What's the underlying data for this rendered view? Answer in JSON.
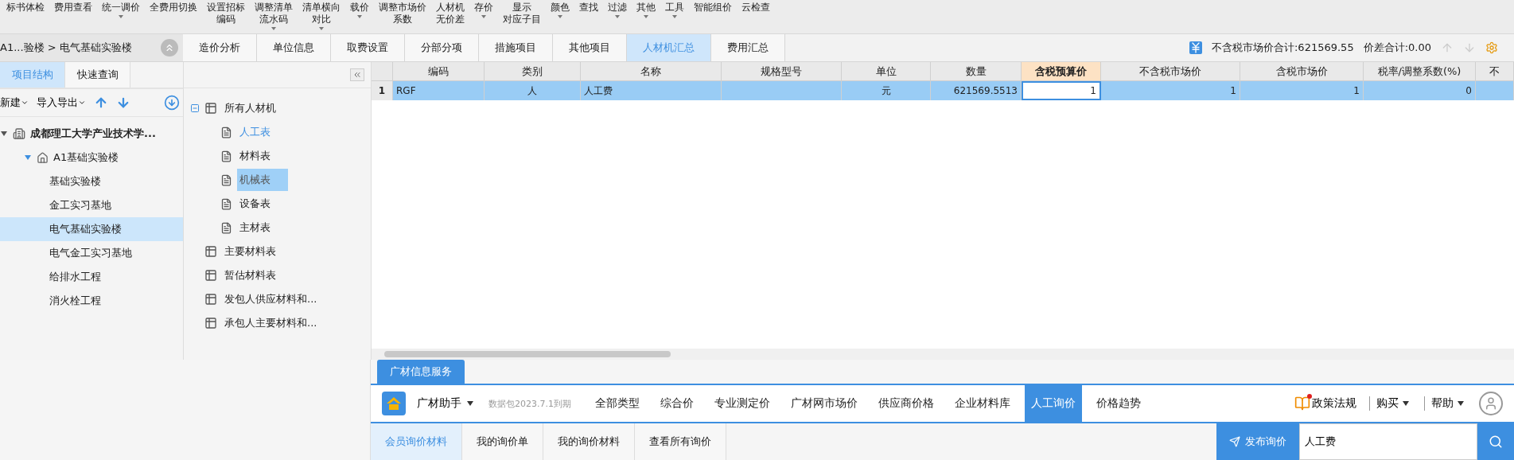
{
  "toolbar": [
    {
      "lines": [
        "标书体检"
      ],
      "dropdown": false
    },
    {
      "lines": [
        "费用查看"
      ],
      "dropdown": false
    },
    {
      "lines": [
        "统一调价"
      ],
      "dropdown": true
    },
    {
      "lines": [
        "全费用切换"
      ],
      "dropdown": false
    },
    {
      "lines": [
        "设置招标",
        "编码"
      ],
      "dropdown": false
    },
    {
      "lines": [
        "调整清单",
        "流水码"
      ],
      "dropdown": true
    },
    {
      "lines": [
        "清单横向",
        "对比"
      ],
      "dropdown": true
    },
    {
      "lines": [
        "载价"
      ],
      "dropdown": true
    },
    {
      "lines": [
        "调整市场价",
        "系数"
      ],
      "dropdown": false
    },
    {
      "lines": [
        "人材机",
        "无价差"
      ],
      "dropdown": false
    },
    {
      "lines": [
        "存价"
      ],
      "dropdown": true
    },
    {
      "lines": [
        "显示",
        "对应子目"
      ],
      "dropdown": false
    },
    {
      "lines": [
        "颜色"
      ],
      "dropdown": true
    },
    {
      "lines": [
        "查找"
      ],
      "dropdown": false
    },
    {
      "lines": [
        "过滤"
      ],
      "dropdown": true
    },
    {
      "lines": [
        "其他"
      ],
      "dropdown": true
    },
    {
      "lines": [
        "工具"
      ],
      "dropdown": true
    },
    {
      "lines": [
        "智能组价"
      ],
      "dropdown": false
    },
    {
      "lines": [
        "云检查"
      ],
      "dropdown": false
    }
  ],
  "breadcrumb": "A1...验楼 > 电气基础实验楼",
  "main_tabs": [
    {
      "label": "造价分析",
      "selected": false
    },
    {
      "label": "单位信息",
      "selected": false
    },
    {
      "label": "取费设置",
      "selected": false
    },
    {
      "label": "分部分项",
      "selected": false
    },
    {
      "label": "措施项目",
      "selected": false
    },
    {
      "label": "其他项目",
      "selected": false
    },
    {
      "label": "人材机汇总",
      "selected": true
    },
    {
      "label": "费用汇总",
      "selected": false
    }
  ],
  "summary": {
    "market_total": "不含税市场价合计:621569.55",
    "diff_total": "价差合计:0.00"
  },
  "left_tabs": [
    {
      "label": "项目结构",
      "selected": true
    },
    {
      "label": "快速查询",
      "selected": false
    }
  ],
  "left_tools": {
    "new": "新建",
    "import_export": "导入导出"
  },
  "project_tree": [
    {
      "label": "成都理工大学产业技术学...",
      "kind": "project",
      "expanded": true,
      "selected": false,
      "children": [
        {
          "label": "A1基础实验楼",
          "kind": "building",
          "expanded": true,
          "selected": false,
          "children": [
            {
              "label": "基础实验楼",
              "selected": false
            },
            {
              "label": "金工实习基地",
              "selected": false
            },
            {
              "label": "电气基础实验楼",
              "selected": true
            },
            {
              "label": "电气金工实习基地",
              "selected": false
            },
            {
              "label": "给排水工程",
              "selected": false
            },
            {
              "label": "消火栓工程",
              "selected": false
            }
          ]
        }
      ]
    }
  ],
  "category_tree": [
    {
      "label": "所有人材机",
      "kind": "group",
      "expanded": true,
      "selected": false,
      "active": false,
      "children": [
        {
          "label": "人工表",
          "kind": "sheet",
          "selected": false,
          "active": true
        },
        {
          "label": "材料表",
          "kind": "sheet",
          "selected": false,
          "active": false
        },
        {
          "label": "机械表",
          "kind": "sheet",
          "selected": true,
          "active": false
        },
        {
          "label": "设备表",
          "kind": "sheet",
          "selected": false,
          "active": false
        },
        {
          "label": "主材表",
          "kind": "sheet",
          "selected": false,
          "active": false
        }
      ]
    },
    {
      "label": "主要材料表",
      "kind": "group",
      "selected": false,
      "active": false
    },
    {
      "label": "暂估材料表",
      "kind": "group",
      "selected": false,
      "active": false
    },
    {
      "label": "发包人供应材料和...",
      "kind": "group",
      "selected": false,
      "active": false
    },
    {
      "label": "承包人主要材料和...",
      "kind": "group",
      "selected": false,
      "active": false
    }
  ],
  "table": {
    "columns": [
      {
        "label": "编码",
        "selected": false
      },
      {
        "label": "类别",
        "selected": false
      },
      {
        "label": "名称",
        "selected": false
      },
      {
        "label": "规格型号",
        "selected": false
      },
      {
        "label": "单位",
        "selected": false
      },
      {
        "label": "数量",
        "selected": false
      },
      {
        "label": "含税预算价",
        "selected": true
      },
      {
        "label": "不含税市场价",
        "selected": false
      },
      {
        "label": "含税市场价",
        "selected": false
      },
      {
        "label": "税率/调整系数(%)",
        "selected": false
      },
      {
        "label": "不",
        "selected": false
      }
    ],
    "rows": [
      {
        "number": "1",
        "selected": true,
        "cells": [
          "RGF",
          "人",
          "人工费",
          "",
          "元",
          "621569.5513",
          "1",
          "1",
          "1",
          "0",
          ""
        ]
      }
    ]
  },
  "service": {
    "tab": "广材信息服务",
    "assistant": "广材助手",
    "package": "数据包2023.7.1到期",
    "nav": [
      {
        "label": "全部类型",
        "selected": false
      },
      {
        "label": "综合价",
        "selected": false
      },
      {
        "label": "专业测定价",
        "selected": false
      },
      {
        "label": "广材网市场价",
        "selected": false
      },
      {
        "label": "供应商价格",
        "selected": false
      },
      {
        "label": "企业材料库",
        "selected": false
      },
      {
        "label": "人工询价",
        "selected": true
      },
      {
        "label": "价格趋势",
        "selected": false
      }
    ],
    "policy": "政策法规",
    "buy": "购买",
    "help": "帮助",
    "sub_tabs": [
      {
        "label": "会员询价材料",
        "selected": true
      },
      {
        "label": "我的询价单",
        "selected": false
      },
      {
        "label": "我的询价材料",
        "selected": false
      },
      {
        "label": "查看所有询价",
        "selected": false
      }
    ],
    "publish": "发布询价",
    "search_value": "人工费"
  }
}
